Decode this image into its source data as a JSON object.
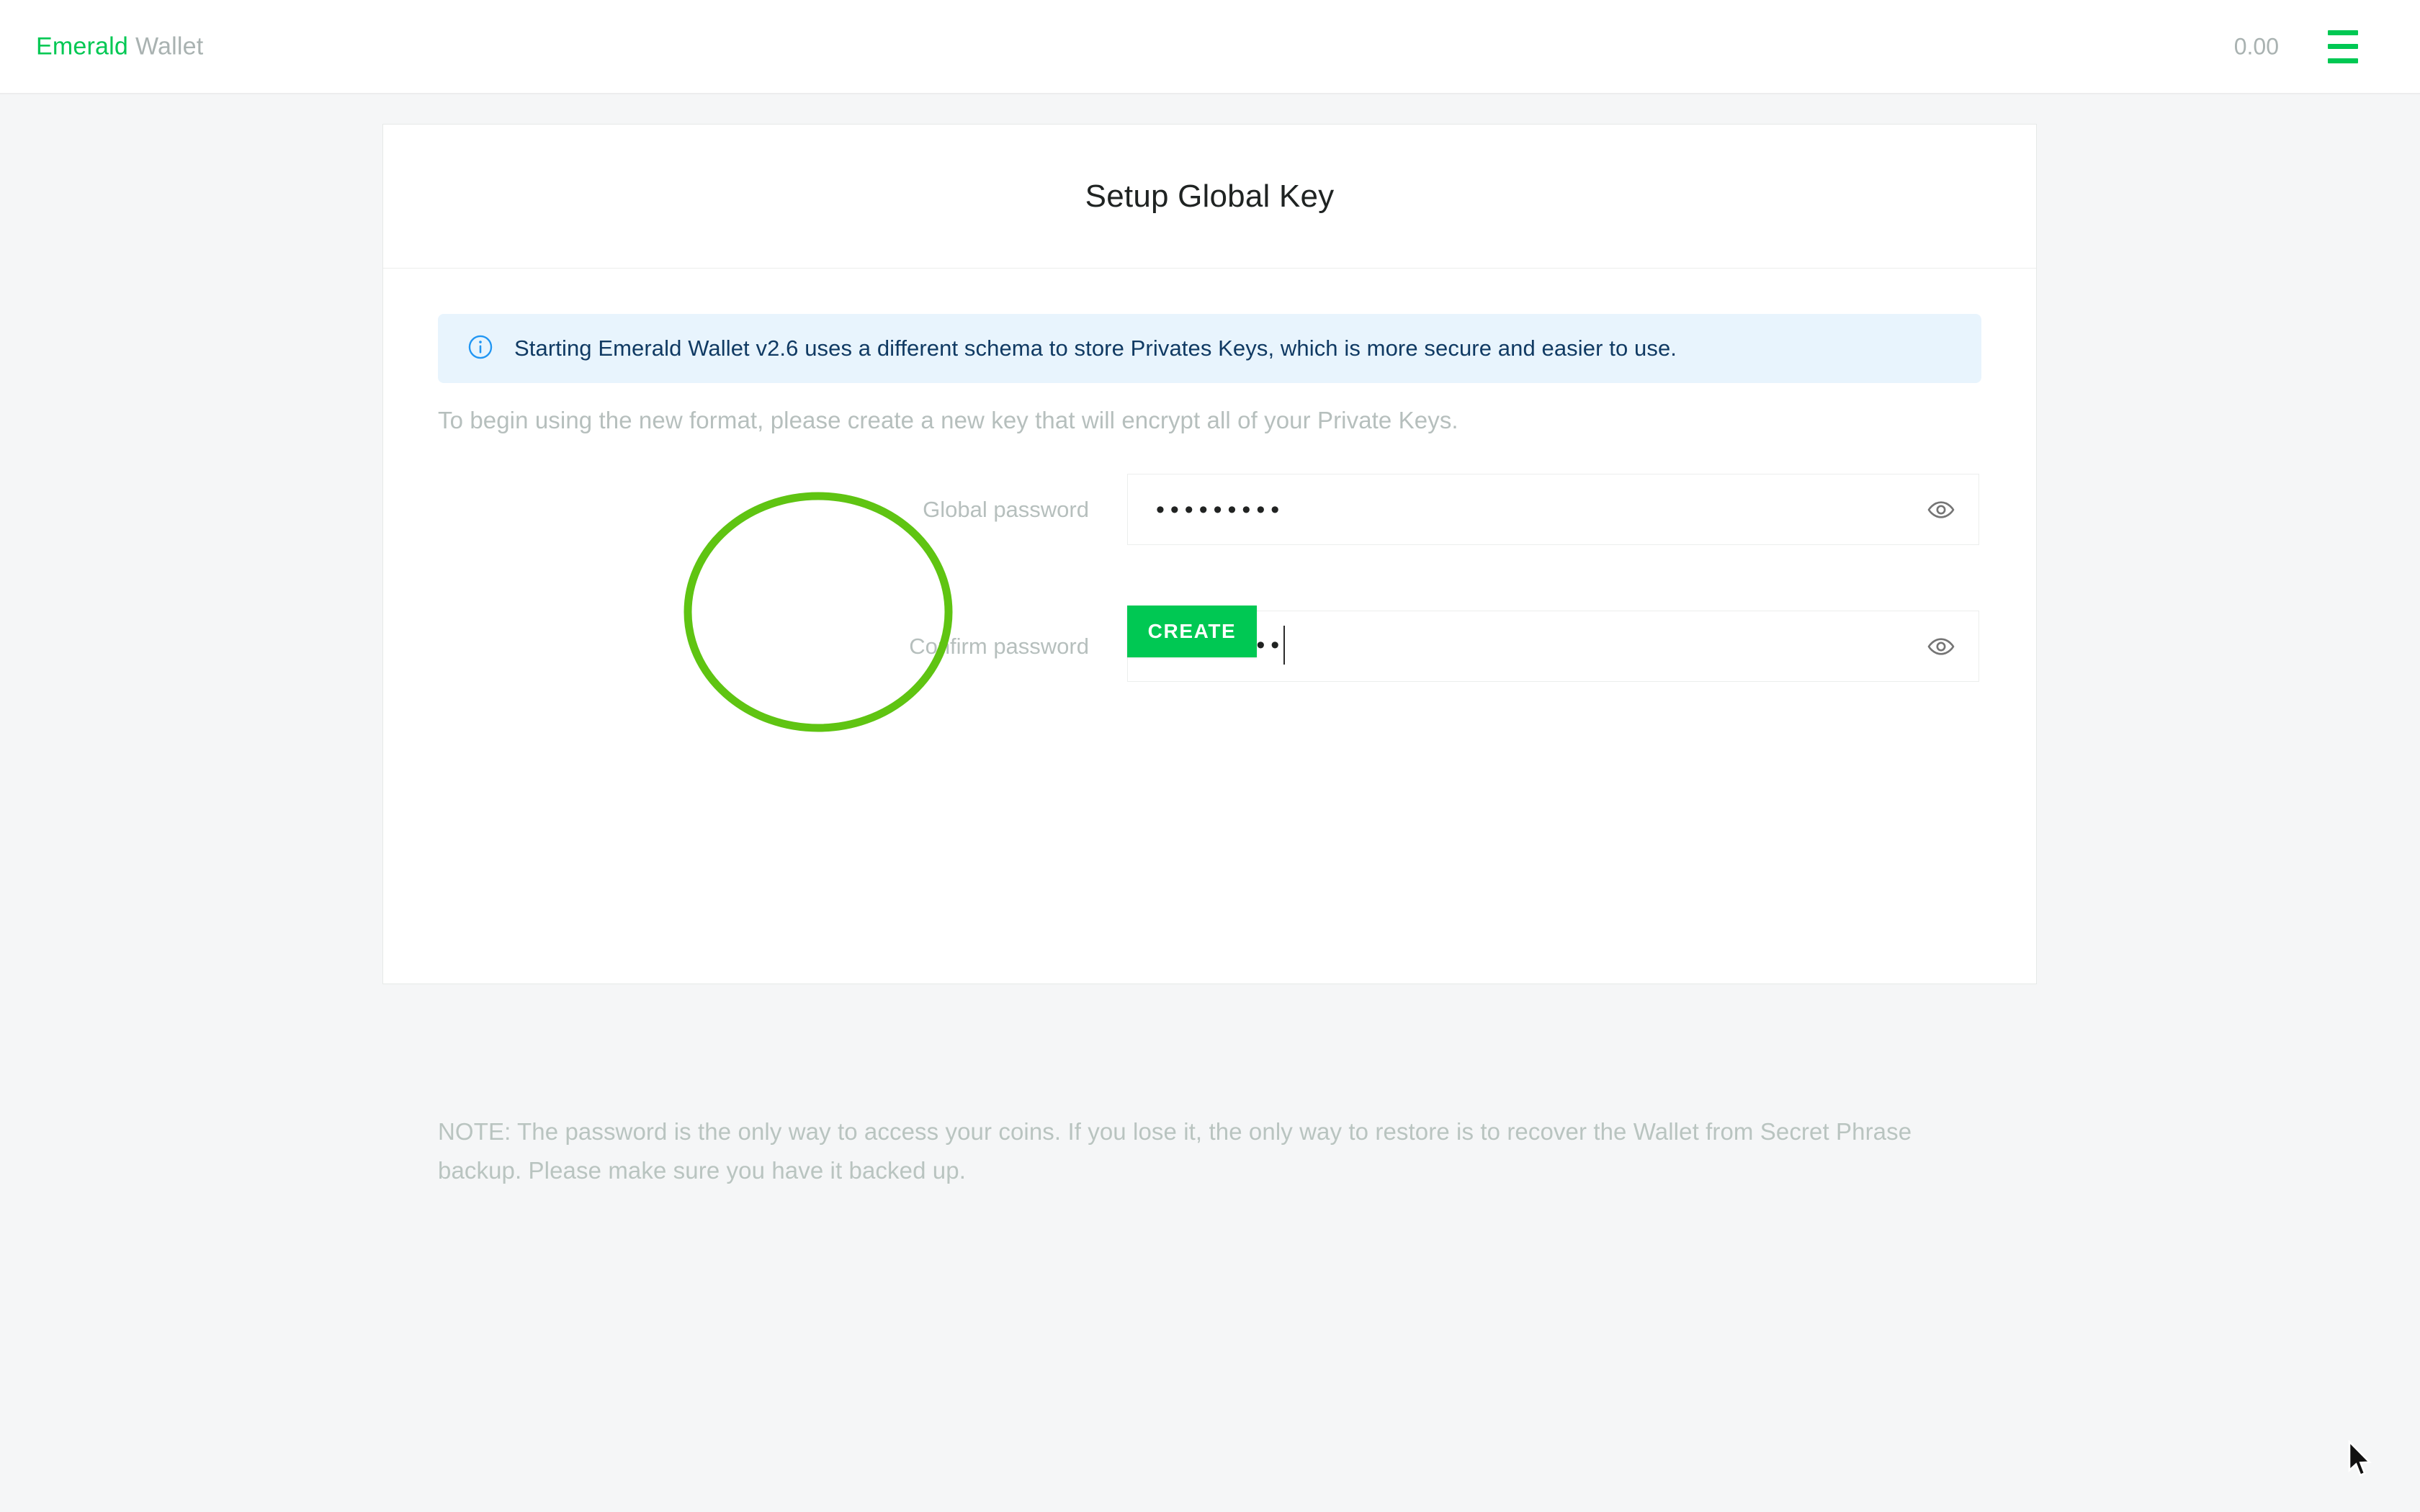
{
  "topbar": {
    "brand_primary": "Emerald",
    "brand_secondary": "Wallet",
    "balance": "0.00",
    "menu_icon": "hamburger-menu-icon",
    "accent_color": "#00c853",
    "muted_color": "#a9b2b1"
  },
  "card": {
    "title": "Setup Global Key",
    "alert": {
      "icon": "info-circle-icon",
      "message": "Starting Emerald Wallet v2.6 uses a different schema to store Privates Keys, which is more secure and easier to use.",
      "background_color": "#e8f4fd",
      "text_color": "#103a63"
    },
    "intro": "To begin using the new format, please create a new key that will encrypt all of your Private Keys.",
    "form": {
      "fields": [
        {
          "label": "Global password",
          "value": "•••••••••",
          "placeholder": "",
          "reveal_icon": "eye-icon",
          "has_caret": false
        },
        {
          "label": "Confirm password",
          "value": "•••••••••",
          "placeholder": "",
          "reveal_icon": "eye-icon",
          "has_caret": true
        }
      ],
      "submit_label": "CREATE",
      "submit_color": "#00c853"
    },
    "note": "NOTE: The password is the only way to access your coins. If you lose it, the only way to restore is to recover the Wallet from Secret Phrase backup. Please make sure you have it backed up."
  },
  "annotation": {
    "shape": "ellipse",
    "color": "#5fc412",
    "stroke_width": "10"
  }
}
